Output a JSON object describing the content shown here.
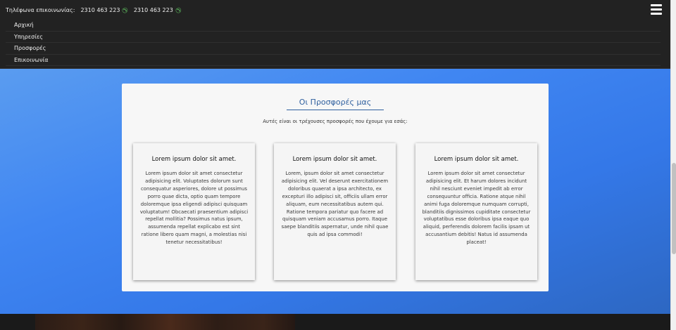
{
  "header": {
    "phone_label": "Τηλέφωνα επικοινωνίας:",
    "phones": [
      "2310 463 223",
      "2310 463 223"
    ],
    "phone_icon": "phone-icon",
    "menu_icon": "hamburger-menu-icon"
  },
  "nav": {
    "items": [
      "Αρχική",
      "Υπηρεσίες",
      "Προσφορές",
      "Επικοινωνία"
    ]
  },
  "offers": {
    "title": "Οι Προσφορές μας",
    "subtitle": "Αυτές είναι οι τρέχουσες προσφορές που έχουμε για εσάς:",
    "cards": [
      {
        "title": "Lorem ipsum dolor sit amet.",
        "body": "Lorem ipsum dolor sit amet consectetur adipisicing elit. Voluptates dolorum sunt consequatur asperiores, dolore ut possimus porro quae dicta, optio quam tempore doloremque ipsa eligendi adipisci quisquam voluptatum! Obcaecati praesentium adipisci repellat mollitia? Possimus natus ipsum, assumenda repellat explicabo est sint ratione libero quam magni, a molestias nisi tenetur necessitatibus!"
      },
      {
        "title": "Lorem ipsum dolor sit amet.",
        "body": "Lorem, ipsum dolor sit amet consectetur adipisicing elit. Vel deserunt exercitationem doloribus quaerat a ipsa architecto, ex excepturi illo adipisci sit, officiis ullam error aliquam, eum necessitatibus autem qui. Ratione tempora pariatur quo facere ad quisquam veniam accusamus porro. Itaque saepe blanditiis aspernatur, unde nihil quae quis ad ipsa commodi!"
      },
      {
        "title": "Lorem ipsum dolor sit amet.",
        "body": "Lorem ipsum dolor sit amet consectetur adipisicing elit. Et harum dolores incidunt nihil nesciunt eveniet impedit ab error consequuntur officia. Ratione atque nihil animi fuga doloremque numquam corrupti, blanditiis dignissimos cupiditate consectetur voluptatibus esse doloribus ipsa eaque quo aliquid, perferendis dolorem facilis ipsam ut accusantium debitis! Natus id assumenda placeat!"
      }
    ]
  },
  "colors": {
    "header_bg": "#222222",
    "phone_icon": "#5cb85c",
    "accent_title": "#2e5f9e",
    "hero_gradient_start": "#5a9cf0",
    "hero_gradient_end": "#2d67c2"
  }
}
